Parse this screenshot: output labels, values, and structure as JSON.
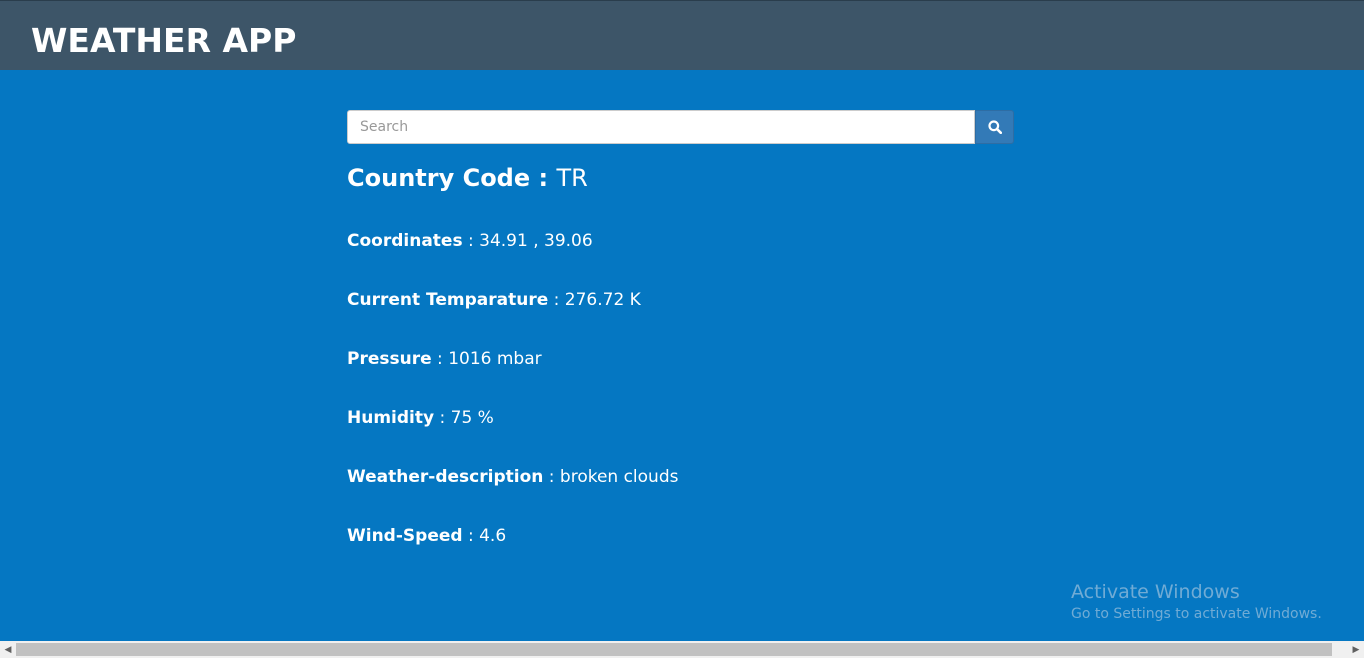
{
  "app": {
    "title": "WEATHER APP"
  },
  "search": {
    "placeholder": "Search",
    "value": "",
    "button_icon": "search-icon"
  },
  "weather": {
    "country_code": {
      "label": "Country Code",
      "sep": " : ",
      "value": "TR"
    },
    "rows": [
      {
        "label": "Coordinates",
        "sep": " : ",
        "value": "34.91 , 39.06"
      },
      {
        "label": "Current Temparature",
        "sep": " : ",
        "value": "276.72 K"
      },
      {
        "label": "Pressure",
        "sep": " : ",
        "value": "1016 mbar"
      },
      {
        "label": "Humidity",
        "sep": " : ",
        "value": "75 %"
      },
      {
        "label": "Weather-description",
        "sep": " : ",
        "value": "broken clouds"
      },
      {
        "label": "Wind-Speed",
        "sep": " : ",
        "value": "4.6"
      }
    ]
  },
  "watermark": {
    "title": "Activate Windows",
    "subtitle": "Go to Settings to activate Windows."
  },
  "colors": {
    "navbar": "#3d5568",
    "background": "#0577c2",
    "button": "#337ab7"
  }
}
